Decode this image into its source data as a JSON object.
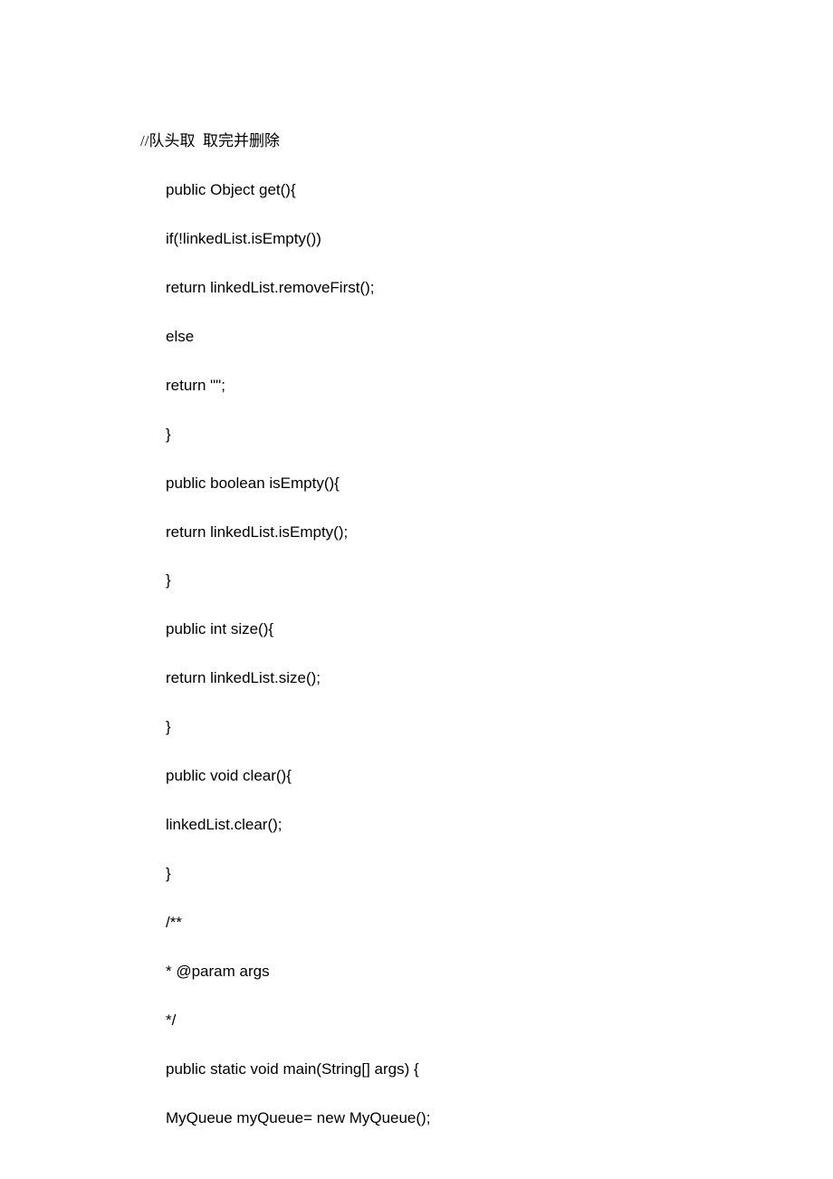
{
  "lines": [
    {
      "text": "//队头取  取完并删除",
      "indent": 0,
      "isComment": true
    },
    {
      "text": "public Object get(){",
      "indent": 1,
      "isComment": false
    },
    {
      "text": "if(!linkedList.isEmpty())",
      "indent": 1,
      "isComment": false
    },
    {
      "text": "return linkedList.removeFirst();",
      "indent": 1,
      "isComment": false
    },
    {
      "text": "else",
      "indent": 1,
      "isComment": false
    },
    {
      "text": "return \"\";",
      "indent": 1,
      "isComment": false
    },
    {
      "text": "}",
      "indent": 1,
      "isComment": false
    },
    {
      "text": "public boolean isEmpty(){",
      "indent": 1,
      "isComment": false
    },
    {
      "text": "return linkedList.isEmpty();",
      "indent": 1,
      "isComment": false
    },
    {
      "text": "}",
      "indent": 1,
      "isComment": false
    },
    {
      "text": "public int size(){",
      "indent": 1,
      "isComment": false
    },
    {
      "text": "return linkedList.size();",
      "indent": 1,
      "isComment": false
    },
    {
      "text": "}",
      "indent": 1,
      "isComment": false
    },
    {
      "text": "public void clear(){",
      "indent": 1,
      "isComment": false
    },
    {
      "text": "linkedList.clear();",
      "indent": 1,
      "isComment": false
    },
    {
      "text": "}",
      "indent": 1,
      "isComment": false
    },
    {
      "text": "/**",
      "indent": 1,
      "isComment": false
    },
    {
      "text": "* @param args",
      "indent": 1,
      "isComment": false
    },
    {
      "text": "*/",
      "indent": 1,
      "isComment": false
    },
    {
      "text": "public static void main(String[] args) {",
      "indent": 1,
      "isComment": false
    },
    {
      "text": "MyQueue myQueue= new MyQueue();",
      "indent": 1,
      "isComment": false
    }
  ]
}
